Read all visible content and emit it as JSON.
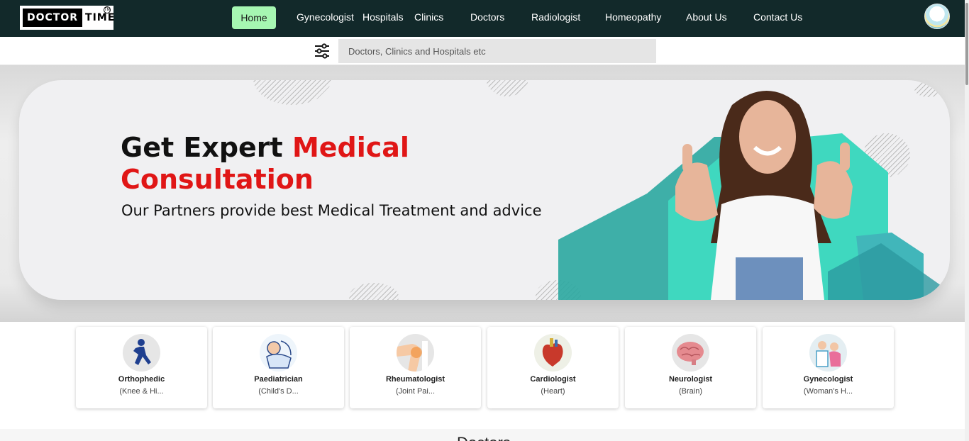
{
  "brand": {
    "logo_left": "DOCTOR",
    "logo_right": "TIME",
    "logo_mark": "TM"
  },
  "nav": {
    "home": "Home",
    "items": [
      "Gynecologist",
      "Hospitals",
      "Clinics",
      "Doctors",
      "Radiologist",
      "Homeopathy",
      "About Us",
      "Contact Us"
    ]
  },
  "search": {
    "placeholder": "Doctors, Clinics and Hospitals etc"
  },
  "hero": {
    "title_black": "Get Expert",
    "title_red_1": "Medical",
    "title_red_2": "Consultation",
    "subtitle": "Our Partners provide best Medical Treatment and advice"
  },
  "categories": [
    {
      "title": "Orthophedic",
      "sub": "(Knee & Hi...",
      "icon": "orthopedic-icon"
    },
    {
      "title": "Paediatrician",
      "sub": "(Child's D...",
      "icon": "paediatric-icon"
    },
    {
      "title": "Rheumatologist",
      "sub": "(Joint Pai...",
      "icon": "joint-icon"
    },
    {
      "title": "Cardiologist",
      "sub": "(Heart)",
      "icon": "heart-icon"
    },
    {
      "title": "Neurologist",
      "sub": "(Brain)",
      "icon": "brain-icon"
    },
    {
      "title": "Gynecologist",
      "sub": "(Woman's H...",
      "icon": "gynecology-icon"
    }
  ],
  "section": {
    "title": "Doctors"
  },
  "colors": {
    "nav_bg": "#12292a",
    "home_bg": "#a6f7b2",
    "accent_red": "#e01616",
    "teal": "#2ec4b0"
  }
}
